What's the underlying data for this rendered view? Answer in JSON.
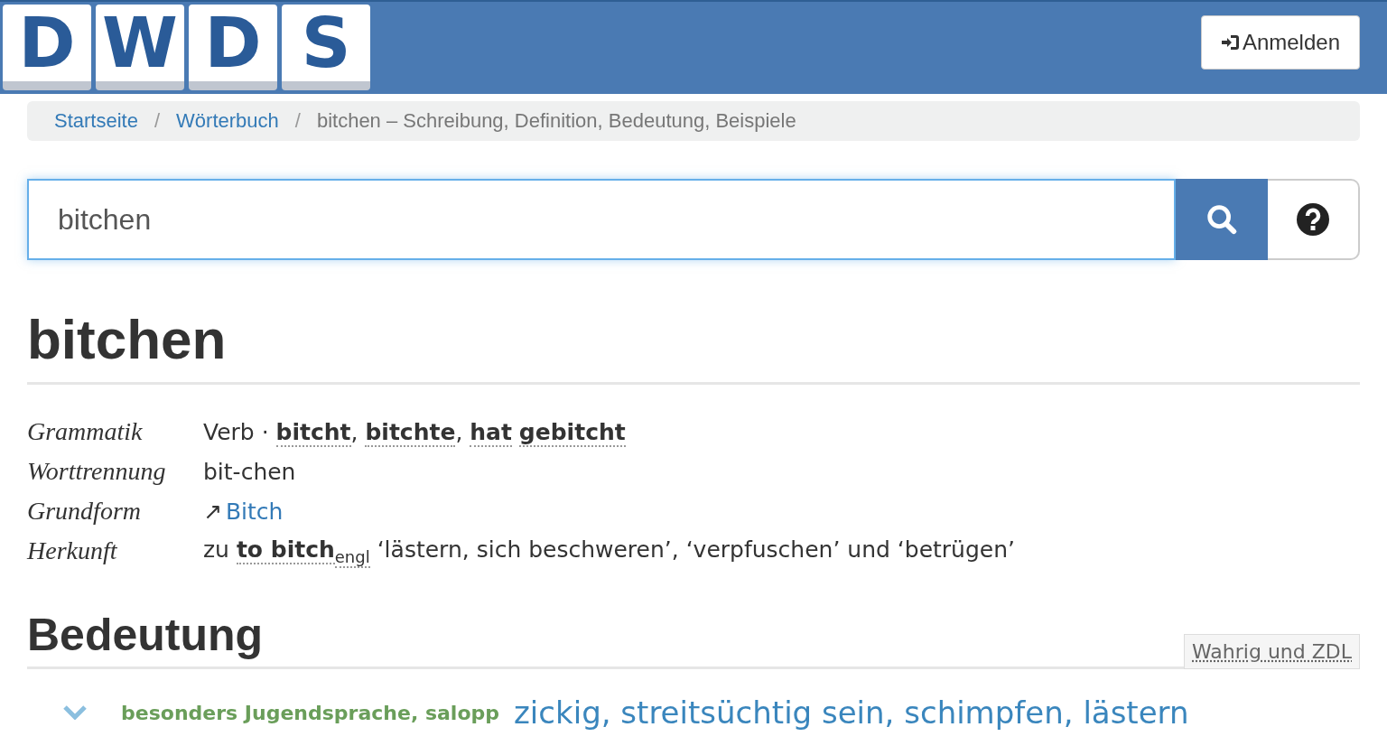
{
  "header": {
    "logo_letters": [
      "D",
      "W",
      "D",
      "S"
    ],
    "login_button": "Anmelden"
  },
  "breadcrumb_separator": "/",
  "breadcrumb": [
    {
      "label": "Startseite",
      "link": true
    },
    {
      "label": "Wörterbuch",
      "link": true
    },
    {
      "label": "bitchen – Schreibung, Definition, Bedeutung, Beispiele",
      "link": false
    }
  ],
  "search": {
    "value": "bitchen"
  },
  "headword": "bitchen",
  "details": [
    {
      "label": "Grammatik",
      "kind": "text",
      "value": "Verb · **bitcht**, **bitchte**, **hat** **gebitcht**"
    },
    {
      "label": "Worttrennung",
      "kind": "text",
      "value": "bit-chen"
    },
    {
      "label": "Grundform",
      "kind": "link",
      "arrow": "↗",
      "value": "Bitch"
    },
    {
      "label": "Herkunft",
      "kind": "text",
      "value": "zu **to bitch**$_{engl}$ ‘lästern, sich beschweren’, ‘verpfuschen’ und ‘betrügen’"
    }
  ],
  "meaning": {
    "heading": "Bedeutung",
    "source": "Wahrig und ZDL",
    "senses": [
      {
        "expanded": false,
        "usage": "besonders Jugendsprache, salopp",
        "definition": "zickig, streitsüchtig sein, schimpfen, lästern"
      }
    ]
  }
}
